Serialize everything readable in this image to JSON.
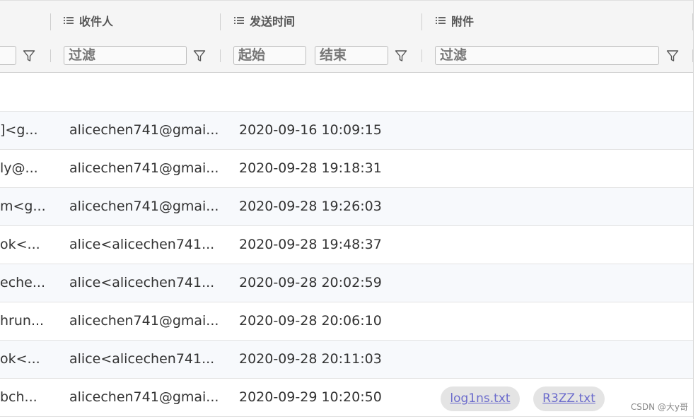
{
  "header": {
    "recipient_label": "收件人",
    "sent_time_label": "发送时间",
    "attachment_label": "附件"
  },
  "filters": {
    "recipient_placeholder": "过滤",
    "start_placeholder": "起始",
    "end_placeholder": "结束",
    "attachment_placeholder": "过滤"
  },
  "rows": [
    {
      "from": "]<g...",
      "to": "alicechen741@gmai...",
      "time": "2020-09-16 10:09:15",
      "attachments": []
    },
    {
      "from": "ly@...",
      "to": "alicechen741@gmai...",
      "time": "2020-09-28 19:18:31",
      "attachments": []
    },
    {
      "from": "m<g...",
      "to": "alicechen741@gmai...",
      "time": "2020-09-28 19:26:03",
      "attachments": []
    },
    {
      "from": "ok<...",
      "to": "alice<alicechen741...",
      "time": "2020-09-28 19:48:37",
      "attachments": []
    },
    {
      "from": "eche...",
      "to": "alice<alicechen741...",
      "time": "2020-09-28 20:02:59",
      "attachments": []
    },
    {
      "from": "hrun...",
      "to": "alicechen741@gmai...",
      "time": "2020-09-28 20:06:10",
      "attachments": []
    },
    {
      "from": "ok<...",
      "to": "alice<alicechen741...",
      "time": "2020-09-28 20:11:03",
      "attachments": []
    },
    {
      "from": "bch...",
      "to": "alicechen741@gmai...",
      "time": "2020-09-29 10:20:50",
      "attachments": [
        "log1ns.txt",
        "R3ZZ.txt"
      ]
    }
  ],
  "watermark": "CSDN @大y哥"
}
